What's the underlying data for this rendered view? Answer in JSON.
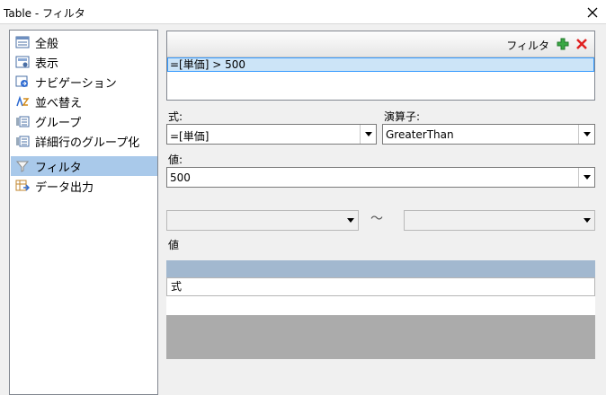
{
  "window": {
    "title": "Table - フィルタ"
  },
  "sidebar": {
    "items": [
      {
        "label": "全般",
        "icon": "general-icon"
      },
      {
        "label": "表示",
        "icon": "display-icon"
      },
      {
        "label": "ナビゲーション",
        "icon": "navigation-icon"
      },
      {
        "label": "並べ替え",
        "icon": "sort-icon"
      },
      {
        "label": "グループ",
        "icon": "group-icon"
      },
      {
        "label": "詳細行のグループ化",
        "icon": "detail-group-icon"
      },
      {
        "label": "フィルタ",
        "icon": "filter-icon",
        "selected": true
      },
      {
        "label": "データ出力",
        "icon": "data-output-icon"
      }
    ]
  },
  "filters": {
    "header_label": "フィルタ",
    "items": [
      "=[単価] > 500"
    ]
  },
  "expression": {
    "label": "式:",
    "value": "=[単価]"
  },
  "operator": {
    "label": "演算子:",
    "value": "GreaterThan"
  },
  "value": {
    "label": "値:",
    "value": "500"
  },
  "range": {
    "tilde": "～",
    "label": "値"
  },
  "values_grid": {
    "column": "式"
  },
  "colors": {
    "selection": "#a9c9ea",
    "filter_row": "#cce4f7",
    "grid_header": "#a2b8cf",
    "grid_empty": "#ababab",
    "add_green": "#3aa845",
    "delete_red": "#e02020"
  }
}
